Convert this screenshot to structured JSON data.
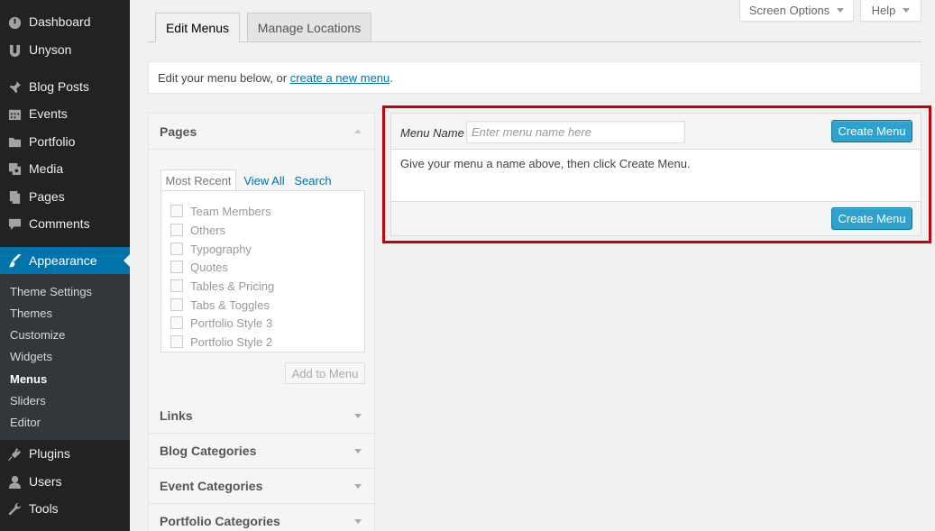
{
  "sidebar": {
    "items": [
      {
        "label": "Dashboard",
        "icon": "dashboard-icon"
      },
      {
        "label": "Unyson",
        "icon": "unyson-icon"
      },
      {
        "label": "Blog Posts",
        "icon": "pin-icon"
      },
      {
        "label": "Events",
        "icon": "calendar-icon"
      },
      {
        "label": "Portfolio",
        "icon": "folder-icon"
      },
      {
        "label": "Media",
        "icon": "media-icon"
      },
      {
        "label": "Pages",
        "icon": "pages-icon"
      },
      {
        "label": "Comments",
        "icon": "comment-icon"
      },
      {
        "label": "Appearance",
        "icon": "brush-icon"
      },
      {
        "label": "Plugins",
        "icon": "plugin-icon"
      },
      {
        "label": "Users",
        "icon": "user-icon"
      },
      {
        "label": "Tools",
        "icon": "wrench-icon"
      }
    ],
    "submenu": [
      "Theme Settings",
      "Themes",
      "Customize",
      "Widgets",
      "Menus",
      "Sliders",
      "Editor"
    ],
    "active_item": "Appearance",
    "current_submenu": "Menus"
  },
  "tabs": {
    "edit": "Edit Menus",
    "manage": "Manage Locations"
  },
  "top_buttons": {
    "screen_options": "Screen Options",
    "help": "Help"
  },
  "notice": {
    "prefix": "Edit your menu below, or ",
    "link": "create a new menu",
    "suffix": "."
  },
  "accordion": {
    "pages_title": "Pages",
    "page_tabs": [
      "Most Recent",
      "View All",
      "Search"
    ],
    "pages": [
      "Team Members",
      "Others",
      "Typography",
      "Quotes",
      "Tables & Pricing",
      "Tabs & Toggles",
      "Portfolio Style 3",
      "Portfolio Style 2"
    ],
    "add_button": "Add to Menu",
    "sections": [
      "Links",
      "Blog Categories",
      "Event Categories",
      "Portfolio Categories"
    ]
  },
  "menu_editor": {
    "name_label": "Menu Name",
    "name_placeholder": "Enter menu name here",
    "create_button": "Create Menu",
    "instruction": "Give your menu a name above, then click Create Menu."
  },
  "colors": {
    "sidebar_bg": "#222222",
    "active_bg": "#0073aa",
    "button_blue": "#2ea2cc",
    "highlight_red": "#c4000a"
  }
}
